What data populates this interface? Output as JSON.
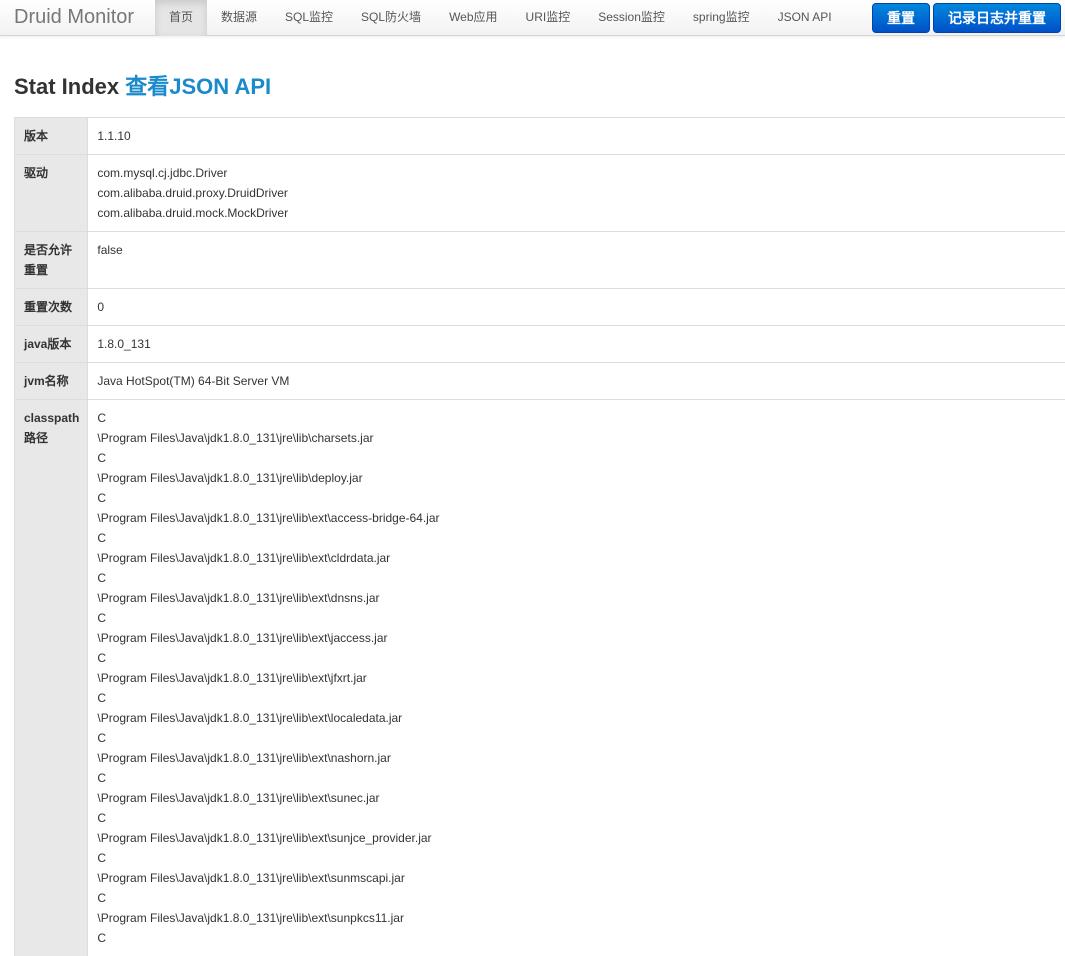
{
  "navbar": {
    "brand": "Druid Monitor",
    "items": [
      {
        "label": "首页",
        "active": true
      },
      {
        "label": "数据源",
        "active": false
      },
      {
        "label": "SQL监控",
        "active": false
      },
      {
        "label": "SQL防火墙",
        "active": false
      },
      {
        "label": "Web应用",
        "active": false
      },
      {
        "label": "URI监控",
        "active": false
      },
      {
        "label": "Session监控",
        "active": false
      },
      {
        "label": "spring监控",
        "active": false
      },
      {
        "label": "JSON API",
        "active": false
      }
    ],
    "reset_label": "重置",
    "log_reset_label": "记录日志并重置"
  },
  "page": {
    "title": "Stat Index",
    "json_link": "查看JSON API"
  },
  "stats": [
    {
      "key": "version",
      "label": "版本",
      "values": [
        "1.1.10"
      ]
    },
    {
      "key": "drivers",
      "label": "驱动",
      "values": [
        "com.mysql.cj.jdbc.Driver",
        "com.alibaba.druid.proxy.DruidDriver",
        "com.alibaba.druid.mock.MockDriver"
      ]
    },
    {
      "key": "reset-enable",
      "label": "是否允许重置",
      "values": [
        "false"
      ]
    },
    {
      "key": "reset-count",
      "label": "重置次数",
      "values": [
        "0"
      ]
    },
    {
      "key": "java-version",
      "label": "java版本",
      "values": [
        "1.8.0_131"
      ]
    },
    {
      "key": "jvm-name",
      "label": "jvm名称",
      "values": [
        "Java HotSpot(TM) 64-Bit Server VM"
      ]
    },
    {
      "key": "classpath",
      "label": "classpath路径",
      "values": [
        "C",
        "\\Program Files\\Java\\jdk1.8.0_131\\jre\\lib\\charsets.jar",
        "C",
        "\\Program Files\\Java\\jdk1.8.0_131\\jre\\lib\\deploy.jar",
        "C",
        "\\Program Files\\Java\\jdk1.8.0_131\\jre\\lib\\ext\\access-bridge-64.jar",
        "C",
        "\\Program Files\\Java\\jdk1.8.0_131\\jre\\lib\\ext\\cldrdata.jar",
        "C",
        "\\Program Files\\Java\\jdk1.8.0_131\\jre\\lib\\ext\\dnsns.jar",
        "C",
        "\\Program Files\\Java\\jdk1.8.0_131\\jre\\lib\\ext\\jaccess.jar",
        "C",
        "\\Program Files\\Java\\jdk1.8.0_131\\jre\\lib\\ext\\jfxrt.jar",
        "C",
        "\\Program Files\\Java\\jdk1.8.0_131\\jre\\lib\\ext\\localedata.jar",
        "C",
        "\\Program Files\\Java\\jdk1.8.0_131\\jre\\lib\\ext\\nashorn.jar",
        "C",
        "\\Program Files\\Java\\jdk1.8.0_131\\jre\\lib\\ext\\sunec.jar",
        "C",
        "\\Program Files\\Java\\jdk1.8.0_131\\jre\\lib\\ext\\sunjce_provider.jar",
        "C",
        "\\Program Files\\Java\\jdk1.8.0_131\\jre\\lib\\ext\\sunmscapi.jar",
        "C",
        "\\Program Files\\Java\\jdk1.8.0_131\\jre\\lib\\ext\\sunpkcs11.jar",
        "C"
      ]
    }
  ],
  "colors": {
    "link": "#1a8acb",
    "button": "#0066cc",
    "label_bg": "#e8e8e8"
  }
}
